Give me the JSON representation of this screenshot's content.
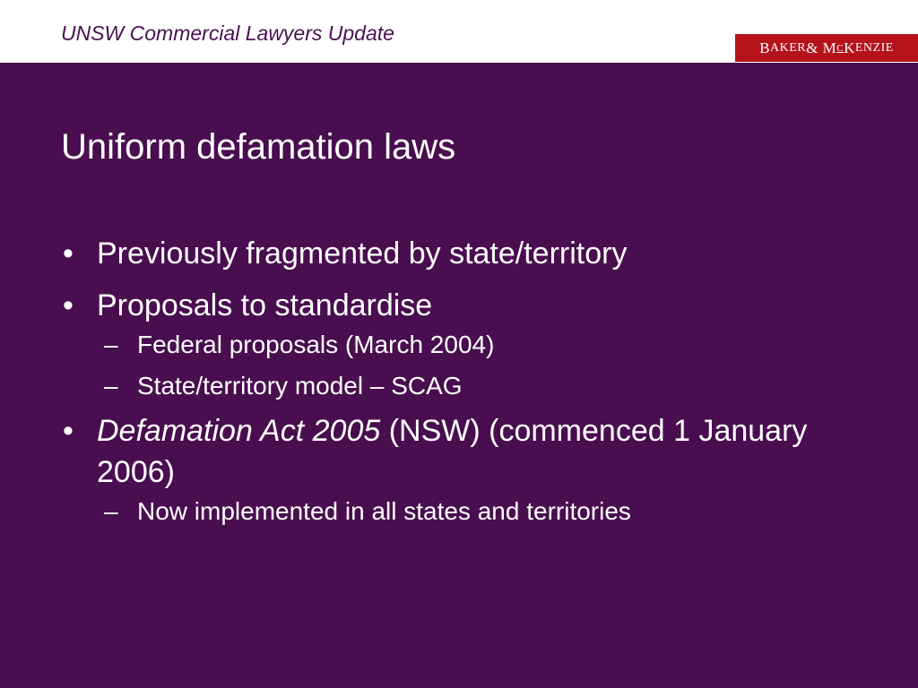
{
  "header": {
    "title": "UNSW Commercial Lawyers Update"
  },
  "logo": {
    "b": "B",
    "aker": "AKER",
    "amp": " & M",
    "c": "C",
    "k": "K",
    "enzie": "ENZIE"
  },
  "slide": {
    "title": "Uniform defamation laws",
    "bullet_mark": "•",
    "dash_mark": "–",
    "items": [
      {
        "text": "Previously fragmented by state/territory"
      },
      {
        "text": "Proposals to standardise"
      },
      {
        "text": "Federal proposals (March 2004)"
      },
      {
        "text": "State/territory model – SCAG"
      },
      {
        "italic": "Defamation Act 2005",
        "text": " (NSW) (commenced 1 January 2006)"
      },
      {
        "text": "Now implemented in all states and territories"
      }
    ]
  },
  "colors": {
    "background": "#490e4f",
    "header_text": "#4a1152",
    "logo_bg": "#b5121b"
  }
}
